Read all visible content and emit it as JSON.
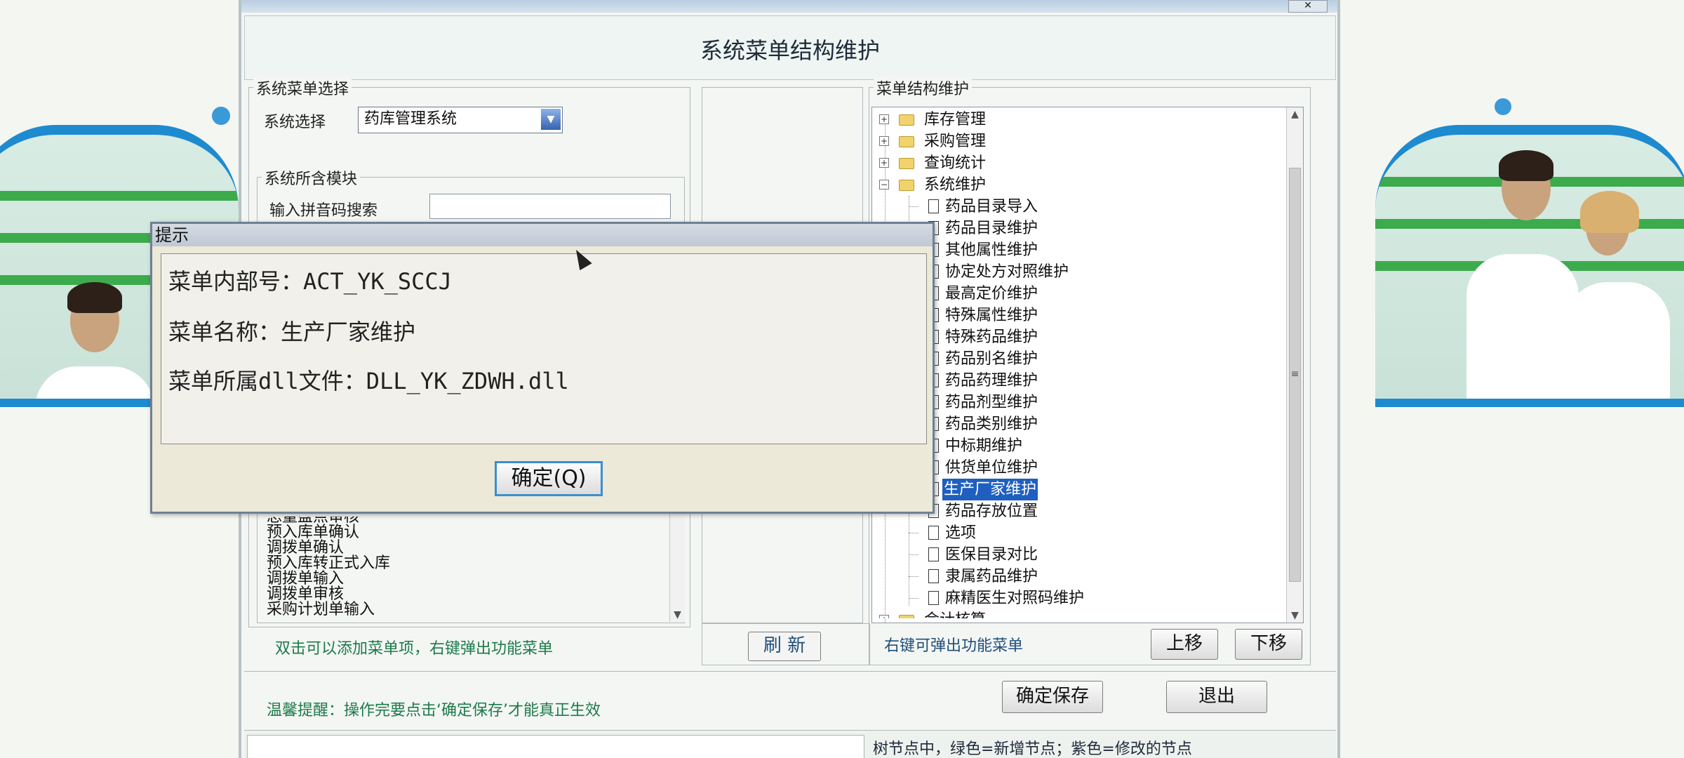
{
  "window": {
    "heading": "系统菜单结构维护",
    "close_label": "✕"
  },
  "left_panel": {
    "group_title": "系统菜单选择",
    "system_label": "系统选择",
    "system_value": "药库管理系统",
    "modules_title": "系统所含模块",
    "search_label": "输入拼音码搜索",
    "search_value": "",
    "partial_item": "总量盘点审核",
    "list_items": [
      "预入库单确认",
      "调拨单确认",
      "预入库转正式入库",
      "调拨单输入",
      "调拨单审核",
      "采购计划单输入"
    ],
    "hint": "双击可以添加菜单项，右键弹出功能菜单"
  },
  "middle": {
    "refresh_label": "刷  新"
  },
  "tree_panel": {
    "group_title": "菜单结构维护",
    "folders": [
      {
        "label": "库存管理",
        "expanded": false
      },
      {
        "label": "采购管理",
        "expanded": false
      },
      {
        "label": "查询统计",
        "expanded": false
      },
      {
        "label": "系统维护",
        "expanded": true
      }
    ],
    "children": [
      "药品目录导入",
      "药品目录维护",
      "其他属性维护",
      "协定处方对照维护",
      "最高定价维护",
      "特殊属性维护",
      "特殊药品维护",
      "药品别名维护",
      "药品药理维护",
      "药品剂型维护",
      "药品类别维护",
      "中标期维护",
      "供货单位维护",
      "生产厂家维护",
      "药品存放位置",
      "选项",
      "医保目录对比",
      "隶属药品维护",
      "麻精医生对照码维护"
    ],
    "selected_child": "生产厂家维护",
    "partial_bottom": "会计核算",
    "hint": "右键可弹出功能菜单",
    "up_label": "上移",
    "down_label": "下移"
  },
  "footer": {
    "reminder": "温馨提醒：操作完要点击‘确定保存’才能真正生效",
    "save_label": "确定保存",
    "exit_label": "退出",
    "status_note": "树节点中，绿色=新增节点；紫色=修改的节点"
  },
  "dialog": {
    "title": "提示",
    "line1": "菜单内部号：ACT_YK_SCCJ",
    "line2": "菜单名称：生产厂家维护",
    "line3": "菜单所属dll文件：DLL_YK_ZDWH.dll",
    "ok_label": "确定(Q)"
  },
  "colors": {
    "accent_blue": "#1e8ad0",
    "selection": "#1f5fbf",
    "hint_green": "#1d7a4a"
  }
}
